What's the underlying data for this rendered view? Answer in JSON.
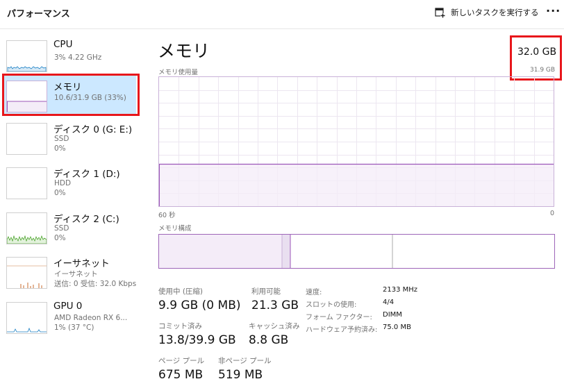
{
  "header": {
    "title": "パフォーマンス",
    "new_task_label": "新しいタスクを実行する",
    "more_label": "···"
  },
  "sidebar": {
    "items": [
      {
        "name": "CPU",
        "line1": "3%  4.22 GHz",
        "line2": "",
        "icon": "cpu-graph-thumb"
      },
      {
        "name": "メモリ",
        "line1": "10.6/31.9 GB (33%)",
        "line2": "",
        "icon": "memory-graph-thumb"
      },
      {
        "name": "ディスク 0 (G: E:)",
        "line1": "SSD",
        "line2": "0%",
        "icon": "disk-graph-thumb"
      },
      {
        "name": "ディスク 1 (D:)",
        "line1": "HDD",
        "line2": "0%",
        "icon": "disk-graph-thumb"
      },
      {
        "name": "ディスク 2 (C:)",
        "line1": "SSD",
        "line2": "0%",
        "icon": "disk-graph-thumb"
      },
      {
        "name": "イーサネット",
        "line1": "イーサネット",
        "line2": "送信: 0  受信: 32.0 Kbps",
        "icon": "ethernet-graph-thumb"
      },
      {
        "name": "GPU 0",
        "line1": "AMD Radeon RX 6...",
        "line2": "1% (37 °C)",
        "icon": "gpu-graph-thumb"
      }
    ],
    "selected_index": 1
  },
  "main": {
    "title": "メモリ",
    "capacity": "32.0 GB",
    "usage_label": "メモリ使用量",
    "usage_max": "31.9 GB",
    "time_left_label": "60 秒",
    "time_right_label": "0",
    "usage_fraction": 0.33,
    "composition_label": "メモリ構成",
    "stats": {
      "in_use_label": "使用中 (圧縮)",
      "in_use_value": "9.9 GB (0 MB)",
      "available_label": "利用可能",
      "available_value": "21.3 GB",
      "committed_label": "コミット済み",
      "committed_value": "13.8/39.9 GB",
      "cached_label": "キャッシュ済み",
      "cached_value": "8.8 GB",
      "paged_pool_label": "ページ プール",
      "paged_pool_value": "675 MB",
      "nonpaged_pool_label": "非ページ プール",
      "nonpaged_pool_value": "519 MB"
    },
    "specs": [
      {
        "label": "速度:",
        "value": "2133 MHz"
      },
      {
        "label": "スロットの使用:",
        "value": "4/4"
      },
      {
        "label": "フォーム ファクター:",
        "value": "DIMM"
      },
      {
        "label": "ハードウェア予約済み:",
        "value": "75.0 MB"
      }
    ]
  },
  "colors": {
    "memory_accent": "#9b56b8",
    "memory_fill": "#f4ecf8",
    "cpu_accent": "#1a7fc4",
    "disk_accent": "#4aa32a",
    "ethernet_accent": "#c86b2d",
    "selection": "#cce8ff",
    "highlight": "#e8161b"
  }
}
